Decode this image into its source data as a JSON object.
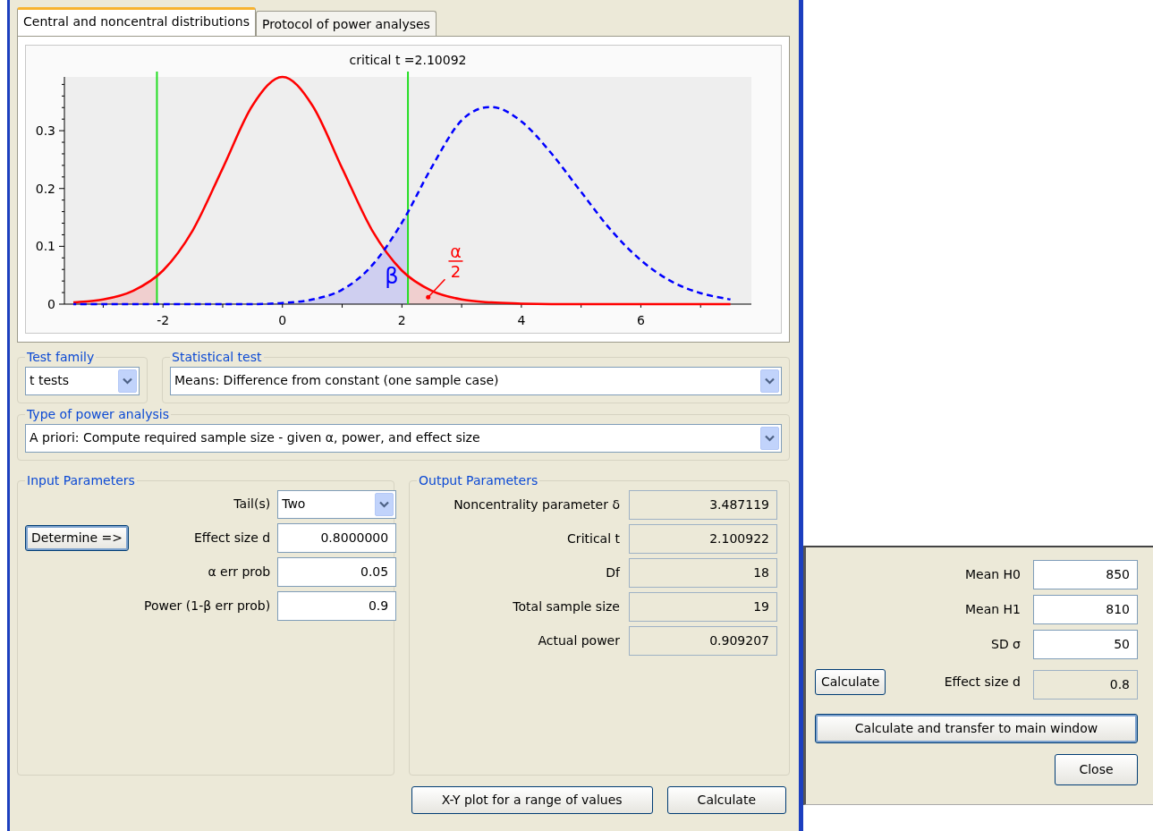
{
  "tabs": [
    {
      "label": "Central and noncentral distributions",
      "selected": true
    },
    {
      "label": "Protocol of power analyses",
      "selected": false
    }
  ],
  "chart": {
    "chart_data": {
      "type": "line",
      "title": "critical t =2.10092",
      "x": [
        -3.5,
        -3,
        -2.5,
        -2,
        -1.5,
        -1,
        -0.5,
        0,
        0.5,
        1,
        1.5,
        2,
        2.5,
        3,
        3.5,
        4,
        4.5,
        5,
        5.5,
        6,
        6.5,
        7,
        7.5
      ],
      "series": [
        {
          "color": "#ff0000",
          "line_style": "solid",
          "values": [
            0.003,
            0.008,
            0.023,
            0.058,
            0.128,
            0.235,
            0.344,
            0.393,
            0.344,
            0.235,
            0.128,
            0.058,
            0.023,
            0.008,
            0.003,
            0.001,
            0,
            0,
            0,
            0,
            0,
            0,
            0
          ]
        },
        {
          "color": "#0000ff",
          "line_style": "dashed",
          "values": [
            0,
            0,
            0,
            0,
            0,
            0,
            0,
            0.002,
            0.008,
            0.025,
            0.067,
            0.141,
            0.237,
            0.318,
            0.341,
            0.316,
            0.261,
            0.194,
            0.128,
            0.076,
            0.04,
            0.019,
            0.008
          ]
        }
      ],
      "xlim": [
        -3.65,
        7.85
      ],
      "ylim": [
        0,
        0.393
      ],
      "xticks": [
        -2,
        0,
        2,
        4,
        6
      ],
      "yticks": [
        0,
        0.1,
        0.2,
        0.3
      ],
      "ref_lines": [
        {
          "axis": "x",
          "value": -2.10092,
          "color": "#22dd22"
        },
        {
          "axis": "x",
          "value": 2.10092,
          "color": "#22dd22"
        }
      ],
      "annotations": [
        "β",
        "α",
        "2"
      ]
    }
  },
  "test_family": {
    "label": "Test family",
    "value": "t tests"
  },
  "statistical_test": {
    "label": "Statistical test",
    "value": "Means: Difference from constant (one sample case)"
  },
  "power_analysis_type": {
    "label": "Type of power analysis",
    "value": "A priori: Compute required sample size - given α, power, and effect size"
  },
  "input_parameters": {
    "title": "Input Parameters",
    "determine_button": "Determine =>",
    "fields": [
      {
        "label": "Tail(s)",
        "value": "Two",
        "kind": "dropdown"
      },
      {
        "label": "Effect size d",
        "value": "0.8000000",
        "kind": "input"
      },
      {
        "label": "α err prob",
        "value": "0.05",
        "kind": "input"
      },
      {
        "label": "Power (1-β err prob)",
        "value": "0.9",
        "kind": "input"
      }
    ]
  },
  "output_parameters": {
    "title": "Output Parameters",
    "fields": [
      {
        "label": "Noncentrality parameter δ",
        "value": "3.487119"
      },
      {
        "label": "Critical t",
        "value": "2.100922"
      },
      {
        "label": "Df",
        "value": "18"
      },
      {
        "label": "Total sample size",
        "value": "19"
      },
      {
        "label": "Actual power",
        "value": "0.909207"
      }
    ]
  },
  "buttons": [
    "X-Y plot for a range of values",
    "Calculate"
  ],
  "effect_size_panel": {
    "fields": [
      {
        "label": "Mean H0",
        "value": "850",
        "kind": "input"
      },
      {
        "label": "Mean H1",
        "value": "810",
        "kind": "input"
      },
      {
        "label": "SD σ",
        "value": "50",
        "kind": "input"
      },
      {
        "label": "Effect size d",
        "value": "0.8",
        "kind": "output"
      }
    ],
    "calculate_button": "Calculate",
    "transfer_button": "Calculate and transfer to main window",
    "close_button": "Close"
  }
}
